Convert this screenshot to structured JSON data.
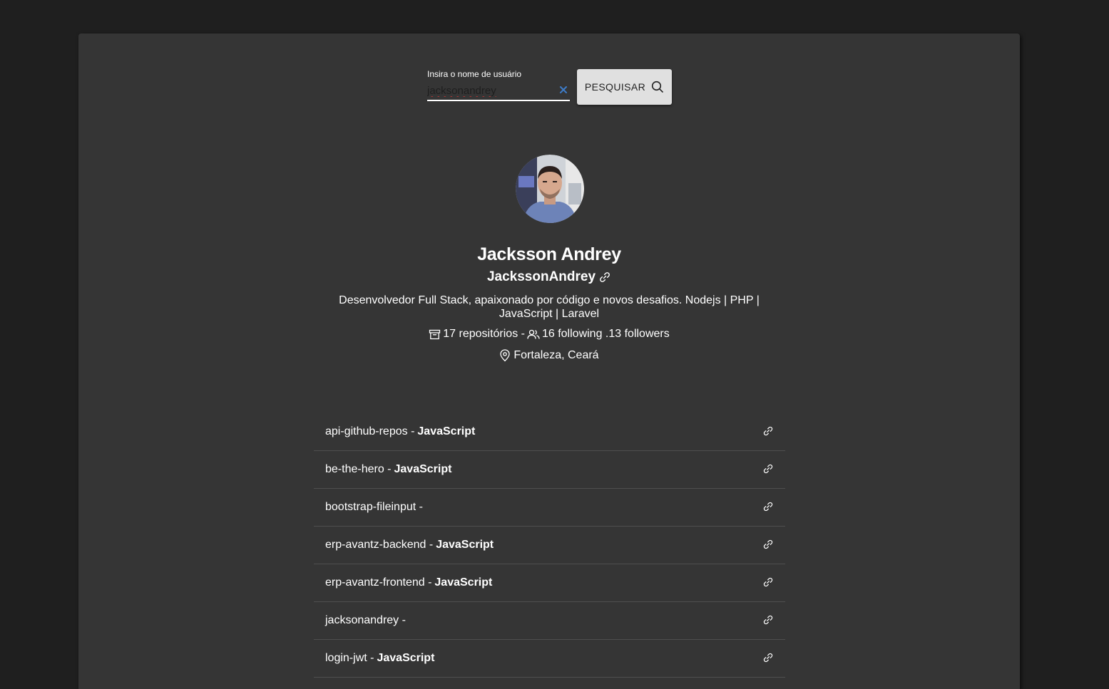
{
  "search": {
    "label": "Insira o nome de usuário",
    "value": "jacksonandrey",
    "button_label": "PESQUISAR"
  },
  "profile": {
    "name": "Jacksson Andrey",
    "login": "JackssonAndrey",
    "bio": "Desenvolvedor Full Stack, apaixonado por código e novos desafios. Nodejs | PHP | JavaScript | Laravel",
    "repos_text": "17 repositórios -",
    "follow_text": "16 following .13 followers",
    "location": "Fortaleza, Ceará"
  },
  "repos": [
    {
      "name": "api-github-repos -",
      "language": "JavaScript"
    },
    {
      "name": "be-the-hero -",
      "language": "JavaScript"
    },
    {
      "name": "bootstrap-fileinput -",
      "language": ""
    },
    {
      "name": "erp-avantz-backend -",
      "language": "JavaScript"
    },
    {
      "name": "erp-avantz-frontend -",
      "language": "JavaScript"
    },
    {
      "name": "jacksonandrey -",
      "language": ""
    },
    {
      "name": "login-jwt -",
      "language": "JavaScript"
    }
  ],
  "icons": {
    "clear": "close-icon",
    "search": "search-icon",
    "link": "link-icon",
    "repository": "archive-icon",
    "people": "people-icon",
    "location": "location-pin-icon"
  },
  "colors": {
    "background": "#1f1f1f",
    "card": "#353535",
    "clear_icon": "#3d7cc9",
    "button": "#e0e0e0"
  }
}
